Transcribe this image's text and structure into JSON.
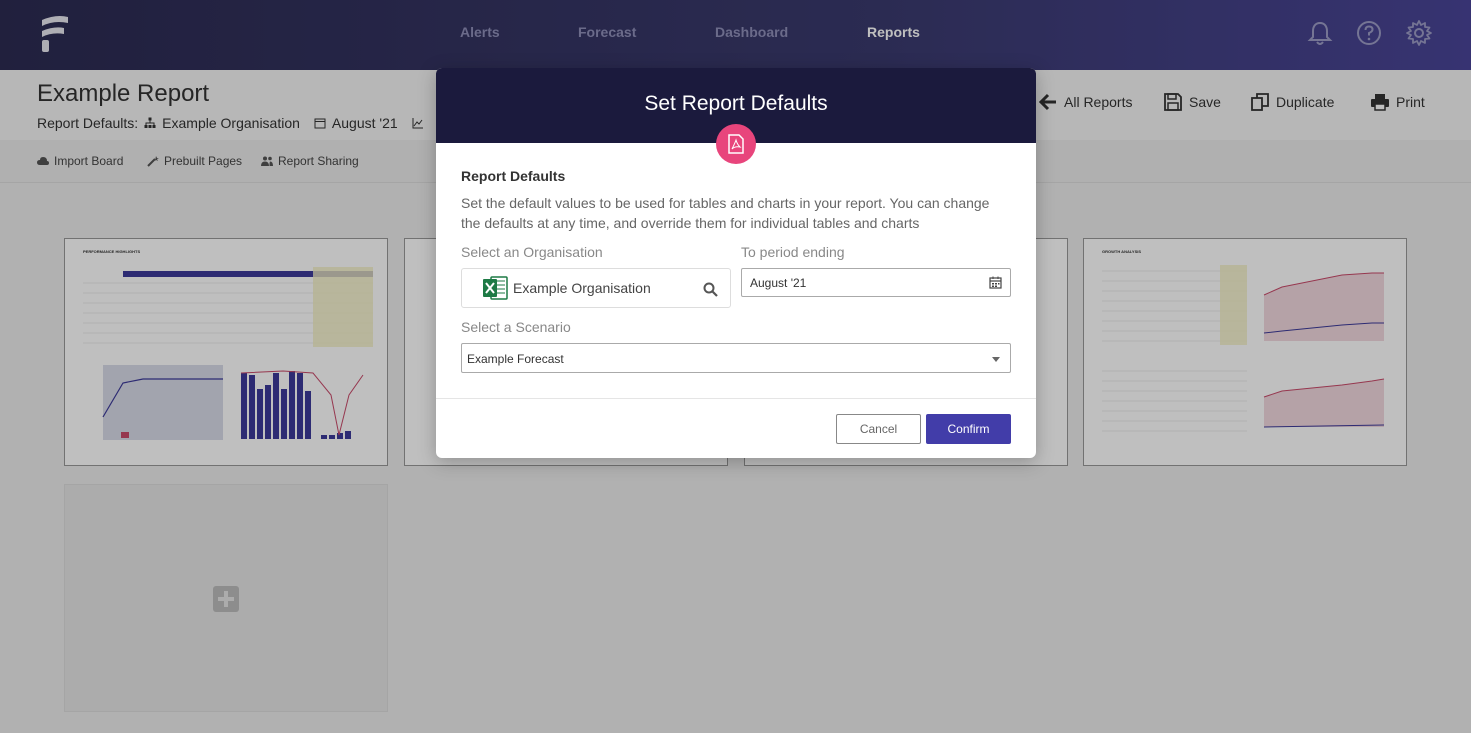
{
  "nav": {
    "links": [
      {
        "label": "Alerts",
        "active": false
      },
      {
        "label": "Forecast",
        "active": false
      },
      {
        "label": "Dashboard",
        "active": false
      },
      {
        "label": "Reports",
        "active": true
      }
    ],
    "icons": [
      "bell-icon",
      "help-icon",
      "settings-icon"
    ]
  },
  "header": {
    "title": "Example Report",
    "defaults_label": "Report Defaults:",
    "organisation": "Example Organisation",
    "period": "August '21",
    "actions": {
      "all_reports": "All Reports",
      "save": "Save",
      "duplicate": "Duplicate",
      "print": "Print"
    }
  },
  "toolbar": {
    "import_board": "Import Board",
    "prebuilt_pages": "Prebuilt Pages",
    "report_sharing": "Report Sharing"
  },
  "thumbnails": [
    {
      "title": "PERFORMANCE HIGHLIGHTS"
    },
    {
      "title": ""
    },
    {
      "title": ""
    },
    {
      "title": "GROWTH ANALYSIS"
    }
  ],
  "modal": {
    "title": "Set Report Defaults",
    "section_title": "Report Defaults",
    "description": "Set the default values to be used for tables and charts in your report. You can change the defaults at any time, and override them for individual tables and charts",
    "org_label": "Select an Organisation",
    "org_value": "Example Organisation",
    "period_label": "To period ending",
    "period_value": "August '21",
    "scenario_label": "Select a Scenario",
    "scenario_value": "Example Forecast",
    "cancel_label": "Cancel",
    "confirm_label": "Confirm"
  },
  "colors": {
    "nav_bg": "#2c2b52",
    "modal_header": "#1b1a3d",
    "accent_pink": "#e8457c",
    "confirm_button": "#423da9",
    "excel_green": "#1d7a45"
  }
}
